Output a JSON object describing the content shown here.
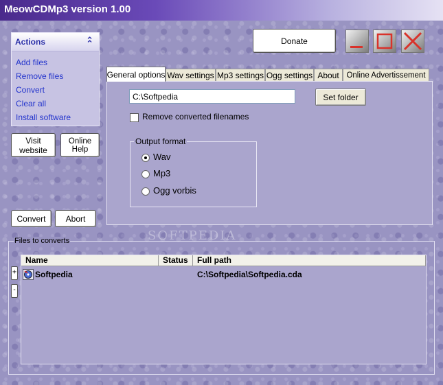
{
  "window": {
    "title": "MeowCDMp3 version 1.00"
  },
  "actions": {
    "header": "Actions",
    "links": [
      "Add files",
      "Remove files",
      "Convert",
      "Clear all",
      "Install software"
    ]
  },
  "buttons": {
    "visit_website": "Visit website",
    "online_help": "Online Help",
    "convert": "Convert",
    "abort": "Abort",
    "donate": "Donate",
    "set_folder": "Set folder",
    "add": "+",
    "remove": "-"
  },
  "tabs": [
    "General options",
    "Wav settings",
    "Mp3 settings",
    "Ogg settings",
    "About",
    "Online  Advertissement"
  ],
  "general": {
    "folder_value": "C:\\Softpedia",
    "remove_converted_label": "Remove converted filenames",
    "remove_converted_checked": false,
    "output_format_legend": "Output format",
    "formats": [
      "Wav",
      "Mp3",
      "Ogg vorbis"
    ],
    "selected_format": "Wav"
  },
  "files": {
    "legend": "Files to converts",
    "columns": [
      "Name",
      "Status",
      "Full path"
    ],
    "rows": [
      {
        "name": "Softpedia",
        "status": "",
        "full_path": "C:\\Softpedia\\Softpedia.cda"
      }
    ]
  },
  "watermark": "SOFTPEDIA",
  "colors": {
    "title_start": "#4a2a8c",
    "link": "#2233cc",
    "close_red": "#d9322a"
  }
}
